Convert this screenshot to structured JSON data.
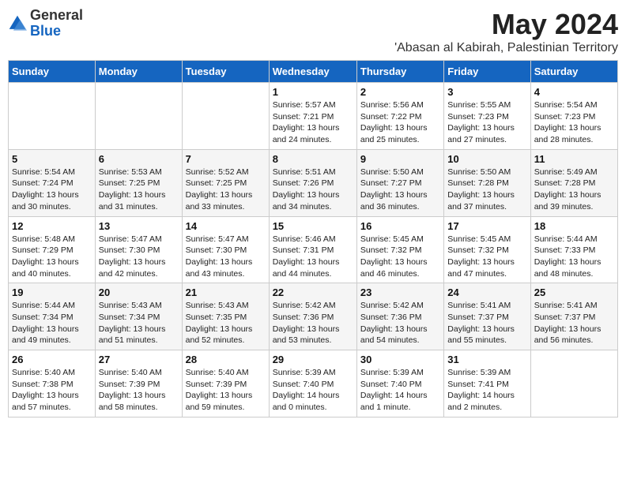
{
  "logo": {
    "general": "General",
    "blue": "Blue"
  },
  "header": {
    "month": "May 2024",
    "location": "'Abasan al Kabirah, Palestinian Territory"
  },
  "weekdays": [
    "Sunday",
    "Monday",
    "Tuesday",
    "Wednesday",
    "Thursday",
    "Friday",
    "Saturday"
  ],
  "weeks": [
    [
      null,
      null,
      null,
      {
        "day": 1,
        "sunrise": "5:57 AM",
        "sunset": "7:21 PM",
        "daylight": "13 hours and 24 minutes."
      },
      {
        "day": 2,
        "sunrise": "5:56 AM",
        "sunset": "7:22 PM",
        "daylight": "13 hours and 25 minutes."
      },
      {
        "day": 3,
        "sunrise": "5:55 AM",
        "sunset": "7:23 PM",
        "daylight": "13 hours and 27 minutes."
      },
      {
        "day": 4,
        "sunrise": "5:54 AM",
        "sunset": "7:23 PM",
        "daylight": "13 hours and 28 minutes."
      }
    ],
    [
      {
        "day": 5,
        "sunrise": "5:54 AM",
        "sunset": "7:24 PM",
        "daylight": "13 hours and 30 minutes."
      },
      {
        "day": 6,
        "sunrise": "5:53 AM",
        "sunset": "7:25 PM",
        "daylight": "13 hours and 31 minutes."
      },
      {
        "day": 7,
        "sunrise": "5:52 AM",
        "sunset": "7:25 PM",
        "daylight": "13 hours and 33 minutes."
      },
      {
        "day": 8,
        "sunrise": "5:51 AM",
        "sunset": "7:26 PM",
        "daylight": "13 hours and 34 minutes."
      },
      {
        "day": 9,
        "sunrise": "5:50 AM",
        "sunset": "7:27 PM",
        "daylight": "13 hours and 36 minutes."
      },
      {
        "day": 10,
        "sunrise": "5:50 AM",
        "sunset": "7:28 PM",
        "daylight": "13 hours and 37 minutes."
      },
      {
        "day": 11,
        "sunrise": "5:49 AM",
        "sunset": "7:28 PM",
        "daylight": "13 hours and 39 minutes."
      }
    ],
    [
      {
        "day": 12,
        "sunrise": "5:48 AM",
        "sunset": "7:29 PM",
        "daylight": "13 hours and 40 minutes."
      },
      {
        "day": 13,
        "sunrise": "5:47 AM",
        "sunset": "7:30 PM",
        "daylight": "13 hours and 42 minutes."
      },
      {
        "day": 14,
        "sunrise": "5:47 AM",
        "sunset": "7:30 PM",
        "daylight": "13 hours and 43 minutes."
      },
      {
        "day": 15,
        "sunrise": "5:46 AM",
        "sunset": "7:31 PM",
        "daylight": "13 hours and 44 minutes."
      },
      {
        "day": 16,
        "sunrise": "5:45 AM",
        "sunset": "7:32 PM",
        "daylight": "13 hours and 46 minutes."
      },
      {
        "day": 17,
        "sunrise": "5:45 AM",
        "sunset": "7:32 PM",
        "daylight": "13 hours and 47 minutes."
      },
      {
        "day": 18,
        "sunrise": "5:44 AM",
        "sunset": "7:33 PM",
        "daylight": "13 hours and 48 minutes."
      }
    ],
    [
      {
        "day": 19,
        "sunrise": "5:44 AM",
        "sunset": "7:34 PM",
        "daylight": "13 hours and 49 minutes."
      },
      {
        "day": 20,
        "sunrise": "5:43 AM",
        "sunset": "7:34 PM",
        "daylight": "13 hours and 51 minutes."
      },
      {
        "day": 21,
        "sunrise": "5:43 AM",
        "sunset": "7:35 PM",
        "daylight": "13 hours and 52 minutes."
      },
      {
        "day": 22,
        "sunrise": "5:42 AM",
        "sunset": "7:36 PM",
        "daylight": "13 hours and 53 minutes."
      },
      {
        "day": 23,
        "sunrise": "5:42 AM",
        "sunset": "7:36 PM",
        "daylight": "13 hours and 54 minutes."
      },
      {
        "day": 24,
        "sunrise": "5:41 AM",
        "sunset": "7:37 PM",
        "daylight": "13 hours and 55 minutes."
      },
      {
        "day": 25,
        "sunrise": "5:41 AM",
        "sunset": "7:37 PM",
        "daylight": "13 hours and 56 minutes."
      }
    ],
    [
      {
        "day": 26,
        "sunrise": "5:40 AM",
        "sunset": "7:38 PM",
        "daylight": "13 hours and 57 minutes."
      },
      {
        "day": 27,
        "sunrise": "5:40 AM",
        "sunset": "7:39 PM",
        "daylight": "13 hours and 58 minutes."
      },
      {
        "day": 28,
        "sunrise": "5:40 AM",
        "sunset": "7:39 PM",
        "daylight": "13 hours and 59 minutes."
      },
      {
        "day": 29,
        "sunrise": "5:39 AM",
        "sunset": "7:40 PM",
        "daylight": "14 hours and 0 minutes."
      },
      {
        "day": 30,
        "sunrise": "5:39 AM",
        "sunset": "7:40 PM",
        "daylight": "14 hours and 1 minute."
      },
      {
        "day": 31,
        "sunrise": "5:39 AM",
        "sunset": "7:41 PM",
        "daylight": "14 hours and 2 minutes."
      },
      null
    ]
  ]
}
